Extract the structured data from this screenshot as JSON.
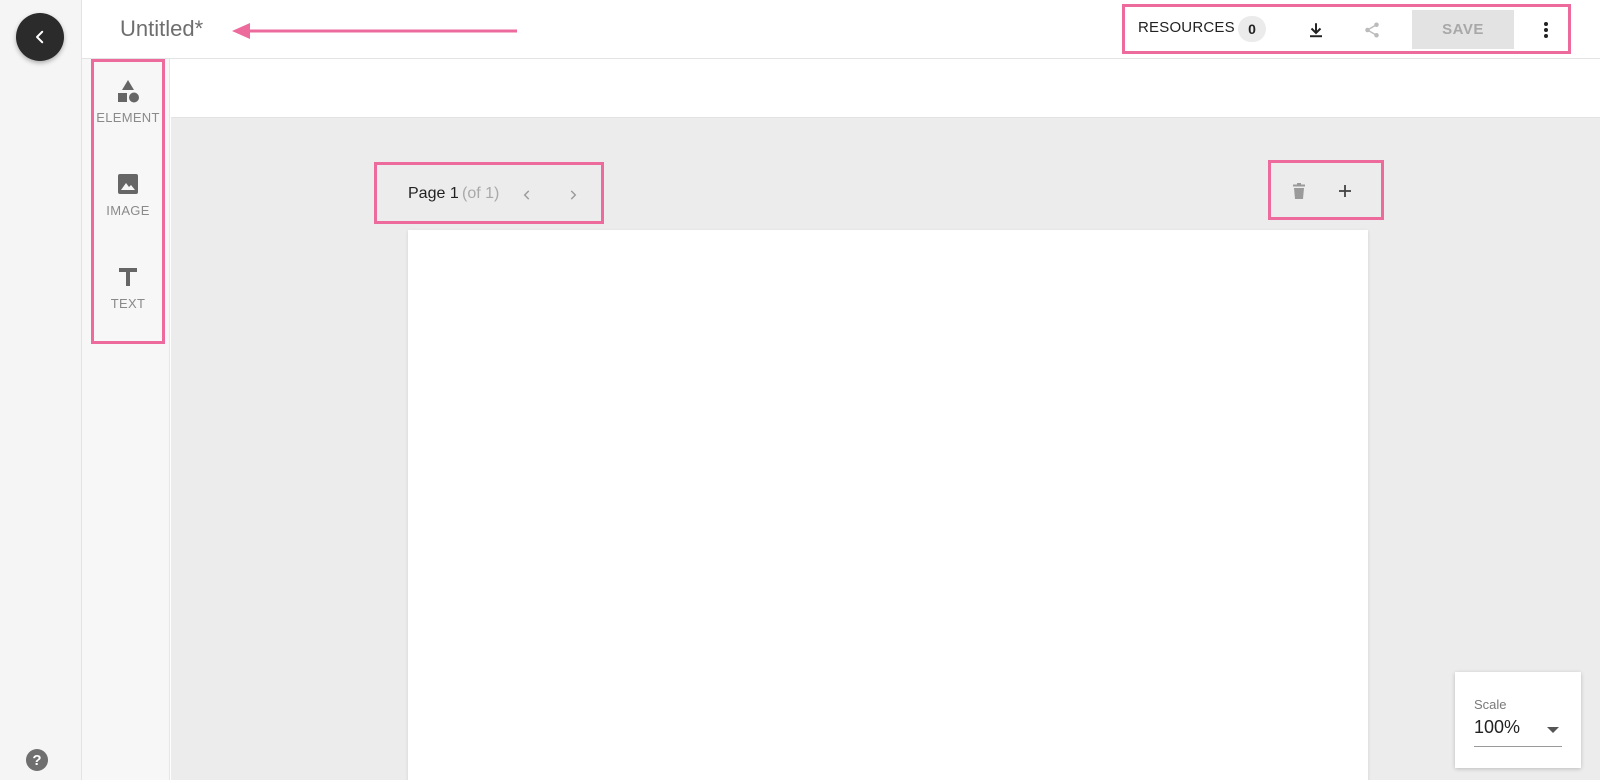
{
  "header": {
    "title": "Untitled*",
    "resources_label": "RESOURCES",
    "resources_count": "0",
    "save_label": "SAVE"
  },
  "tools": [
    {
      "label": "ELEMENT",
      "icon": "shapes-icon"
    },
    {
      "label": "IMAGE",
      "icon": "image-icon"
    },
    {
      "label": "TEXT",
      "icon": "text-icon"
    }
  ],
  "page_nav": {
    "page_label": "Page 1",
    "page_of": "(of 1)"
  },
  "scale": {
    "label": "Scale",
    "value": "100%"
  },
  "colors": {
    "highlight": "#ec6b9c",
    "dark_button": "#2b2b2b",
    "canvas_bg": "#ececec"
  }
}
